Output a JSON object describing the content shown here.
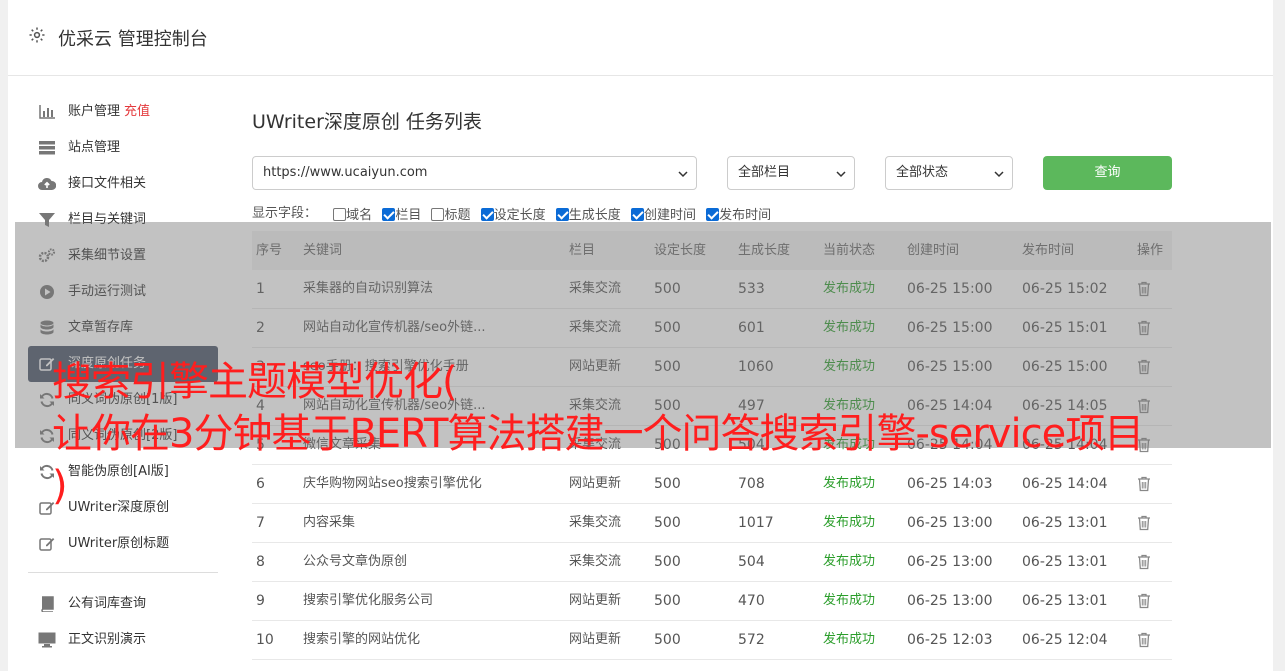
{
  "header": {
    "title": "优采云 管理控制台",
    "icon": "gear-icon"
  },
  "sidebar": {
    "items": [
      {
        "label": "账户管理",
        "extra": "充值",
        "icon": "bar-chart-icon"
      },
      {
        "label": "站点管理",
        "icon": "server-icon"
      },
      {
        "label": "接口文件相关",
        "icon": "cloud-upload-icon"
      },
      {
        "label": "栏目与关键词",
        "icon": "filter-icon"
      },
      {
        "label": "采集细节设置",
        "icon": "cogs-icon"
      },
      {
        "label": "手动运行测试",
        "icon": "play-circle-icon"
      },
      {
        "label": "文章暂存库",
        "icon": "database-icon"
      },
      {
        "label": "深度原创任务",
        "icon": "edit-icon"
      },
      {
        "label": "同义词伪原创[1版]",
        "icon": "refresh-icon"
      },
      {
        "label": "同义词伪原创[2版]",
        "icon": "refresh-icon"
      },
      {
        "label": "智能伪原创[AI版]",
        "icon": "refresh-icon"
      },
      {
        "label": "UWriter深度原创",
        "icon": "edit-icon"
      },
      {
        "label": "UWriter原创标题",
        "icon": "edit-icon"
      }
    ],
    "items2": [
      {
        "label": "公有词库查询",
        "icon": "book-icon"
      },
      {
        "label": "正文识别演示",
        "icon": "monitor-icon"
      }
    ]
  },
  "main": {
    "title": "UWriter深度原创 任务列表",
    "site_select": "https://www.ucaiyun.com",
    "column_select": "全部栏目",
    "status_select": "全部状态",
    "query_label": "查询",
    "fields_label": "显示字段：",
    "fields": [
      {
        "label": "域名",
        "checked": false
      },
      {
        "label": "栏目",
        "checked": true
      },
      {
        "label": "标题",
        "checked": false
      },
      {
        "label": "设定长度",
        "checked": true
      },
      {
        "label": "生成长度",
        "checked": true
      },
      {
        "label": "创建时间",
        "checked": true
      },
      {
        "label": "发布时间",
        "checked": true
      }
    ],
    "columns": [
      "序号",
      "关键词",
      "栏目",
      "设定长度",
      "生成长度",
      "当前状态",
      "创建时间",
      "发布时间",
      "操作"
    ],
    "rows": [
      [
        "1",
        "采集器的自动识别算法",
        "采集交流",
        "500",
        "533",
        "发布成功",
        "06-25 15:00",
        "06-25 15:02"
      ],
      [
        "2",
        "网站自动化宣传机器/seo外链...",
        "采集交流",
        "500",
        "601",
        "发布成功",
        "06-25 15:00",
        "06-25 15:01"
      ],
      [
        "3",
        "seo手册：搜索引擎优化手册",
        "网站更新",
        "500",
        "1060",
        "发布成功",
        "06-25 15:00",
        "06-25 15:00"
      ],
      [
        "4",
        "网站自动化宣传机器/seo外链...",
        "采集交流",
        "500",
        "497",
        "发布成功",
        "06-25 14:04",
        "06-25 14:05"
      ],
      [
        "5",
        "微信文章采集",
        "采集交流",
        "500",
        "504",
        "发布成功",
        "06-25 14:04",
        "06-25 14:04"
      ],
      [
        "6",
        "庆华购物网站seo搜索引擎优化",
        "网站更新",
        "500",
        "708",
        "发布成功",
        "06-25 14:03",
        "06-25 14:04"
      ],
      [
        "7",
        "内容采集",
        "采集交流",
        "500",
        "1017",
        "发布成功",
        "06-25 13:00",
        "06-25 13:01"
      ],
      [
        "8",
        "公众号文章伪原创",
        "采集交流",
        "500",
        "504",
        "发布成功",
        "06-25 13:00",
        "06-25 13:01"
      ],
      [
        "9",
        "搜索引擎优化服务公司",
        "网站更新",
        "500",
        "470",
        "发布成功",
        "06-25 13:00",
        "06-25 13:01"
      ],
      [
        "10",
        "搜索引擎的网站优化",
        "网站更新",
        "500",
        "572",
        "发布成功",
        "06-25 12:03",
        "06-25 12:04"
      ]
    ]
  },
  "overlay": {
    "line1": "搜索引擎主题模型优化(",
    "line2": "让你在3分钟基于BERT算法搭建一个问答搜索引擎-service项目",
    "line3": ")"
  },
  "colors": {
    "active_nav": "#4a5568",
    "query_button": "#5cb85c",
    "status_ok": "#2a9d2a",
    "overlay_text": "#ff1e1e"
  }
}
